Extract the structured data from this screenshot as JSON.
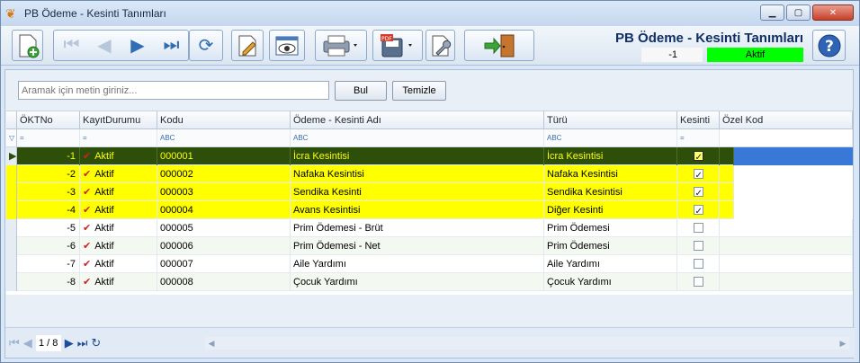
{
  "window": {
    "title": "PB Ödeme - Kesinti Tanımları"
  },
  "header": {
    "form_title": "PB Ödeme - Kesinti Tanımları",
    "record_id": "-1",
    "record_status": "Aktif",
    "status_color": "#00ff00"
  },
  "search": {
    "placeholder": "Aramak için metin giriniz...",
    "find_label": "Bul",
    "clear_label": "Temizle"
  },
  "columns": [
    "ÖKTNo",
    "KayıtDurumu",
    "Kodu",
    "Ödeme - Kesinti Adı",
    "Türü",
    "Kesinti",
    "Özel Kod"
  ],
  "filter_hints": {
    "num": "=",
    "text": "ABC"
  },
  "rows": [
    {
      "no": "-1",
      "status": "Aktif",
      "code": "000001",
      "name": "İcra Kesintisi",
      "type": "İcra Kesintisi",
      "checked": true
    },
    {
      "no": "-2",
      "status": "Aktif",
      "code": "000002",
      "name": "Nafaka Kesintisi",
      "type": "Nafaka Kesintisi",
      "checked": true
    },
    {
      "no": "-3",
      "status": "Aktif",
      "code": "000003",
      "name": "Sendika Kesinti",
      "type": "Sendika Kesintisi",
      "checked": true
    },
    {
      "no": "-4",
      "status": "Aktif",
      "code": "000004",
      "name": "Avans Kesintisi",
      "type": "Diğer Kesinti",
      "checked": true
    },
    {
      "no": "-5",
      "status": "Aktif",
      "code": "000005",
      "name": "Prim Ödemesi - Brüt",
      "type": "Prim Ödemesi",
      "checked": false
    },
    {
      "no": "-6",
      "status": "Aktif",
      "code": "000006",
      "name": "Prim Ödemesi - Net",
      "type": "Prim Ödemesi",
      "checked": false
    },
    {
      "no": "-7",
      "status": "Aktif",
      "code": "000007",
      "name": "Aile Yardımı",
      "type": "Aile Yardımı",
      "checked": false
    },
    {
      "no": "-8",
      "status": "Aktif",
      "code": "000008",
      "name": "Çocuk Yardımı",
      "type": "Çocuk Yardımı",
      "checked": false
    }
  ],
  "pager": {
    "text": "1 / 8"
  }
}
